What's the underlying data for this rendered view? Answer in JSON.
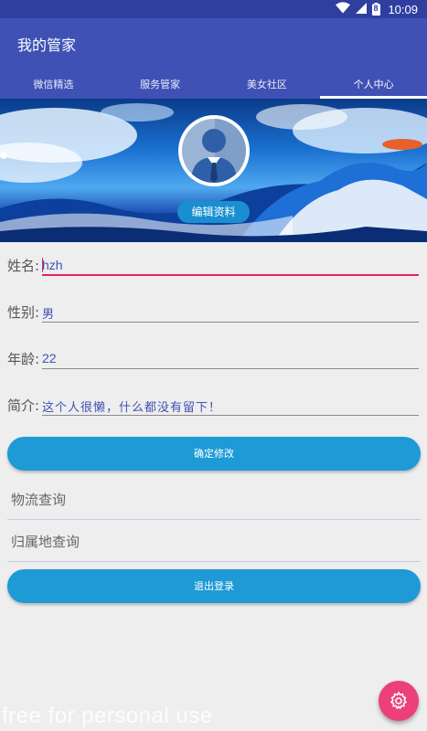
{
  "status_bar": {
    "time": "10:09",
    "battery_level": "8"
  },
  "app_bar": {
    "title": "我的管家",
    "tabs": [
      {
        "label": "微信精选",
        "active": false
      },
      {
        "label": "服务管家",
        "active": false
      },
      {
        "label": "美女社区",
        "active": false
      },
      {
        "label": "个人中心",
        "active": true
      }
    ]
  },
  "profile": {
    "edit_button": "编辑资料"
  },
  "form": {
    "name": {
      "label": "姓名:",
      "value": "hzh"
    },
    "gender": {
      "label": "性别:",
      "value": "男"
    },
    "age": {
      "label": "年龄:",
      "value": "22"
    },
    "bio": {
      "label": "简介:",
      "value": "这个人很懒，什么都没有留下！"
    },
    "confirm_button": "确定修改"
  },
  "menu": {
    "logistics": "物流查询",
    "location": "归属地查询"
  },
  "logout_button": "退出登录",
  "watermark": "free for personal use",
  "colors": {
    "primary": "#3f51b5",
    "primary_dark": "#303f9f",
    "accent": "#e91e63",
    "button": "#1e9ad6",
    "fab": "#ec407a"
  }
}
